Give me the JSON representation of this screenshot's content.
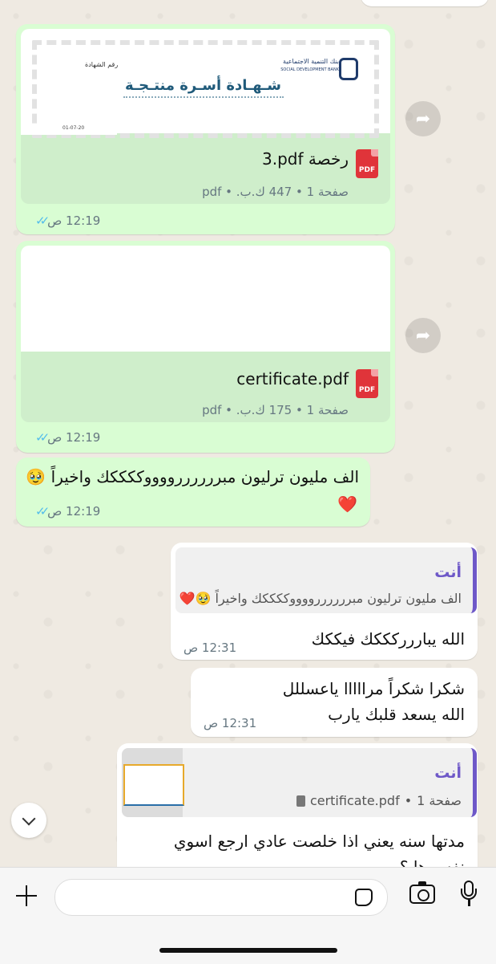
{
  "messages": {
    "doc1": {
      "preview_title": "شـهـادة أسـرة منتـجـة",
      "preview_cert_no": "رقم الشهادة",
      "preview_bank": "بنك التنمية الاجتماعية",
      "preview_bank_en": "SOCIAL DEVELOPMENT BANK",
      "preview_date": "01-07-20",
      "filename": "3.pdf رخصة",
      "file_meta": "صفحة 1 • 447 ك.ب. • pdf",
      "time": "12:19 ص",
      "icon_label": "PDF"
    },
    "doc2": {
      "filename": "certificate.pdf",
      "file_meta": "صفحة 1 • 175 ك.ب. • pdf",
      "time": "12:19 ص",
      "icon_label": "PDF"
    },
    "text1": {
      "line1": "الف مليون ترليون مبررررررووووككككك واخيراً 🥹",
      "line2": "❤️",
      "time": "12:19 ص"
    },
    "reply1": {
      "quote_name": "أنت",
      "quote_text": "الف مليون ترليون مبررررررووووككككك واخيراً 🥹❤️",
      "text": "الله يباررركككك فيككك",
      "time": "12:31 ص"
    },
    "reply2": {
      "line1": "شكرا شكراً مرااااا ياعسللل",
      "line2": "الله يسعد قلبك يارب",
      "time": "12:31 ص"
    },
    "reply3": {
      "quote_name": "أنت",
      "quote_file": "certificate.pdf",
      "quote_meta": "صفحة 1",
      "line1": "مدتها سنه يعني اذا خلصت عادي ارجع اسوي",
      "line2": "نفس ها ؟"
    }
  },
  "input": {
    "placeholder": ""
  },
  "colors": {
    "outgoing_bubble": "#d9fdd3",
    "incoming_bubble": "#ffffff",
    "read_ticks": "#53bdeb",
    "reply_accent": "#6e58c8"
  },
  "icons": [
    "forward-icon",
    "pdf-icon",
    "double-check-icon",
    "scroll-down-icon",
    "plus-icon",
    "sticker-icon",
    "camera-icon",
    "microphone-icon",
    "file-icon"
  ]
}
